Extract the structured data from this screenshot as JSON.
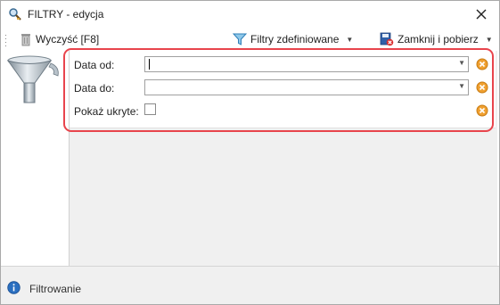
{
  "window": {
    "title": "FILTRY - edycja"
  },
  "toolbar": {
    "clear_label": "Wyczyść [F8]",
    "defined_filters_label": "Filtry zdefiniowane",
    "close_and_fetch_label": "Zamknij i pobierz"
  },
  "form": {
    "date_from": {
      "label": "Data od:",
      "value": ""
    },
    "date_to": {
      "label": "Data do:",
      "value": ""
    },
    "show_hidden": {
      "label": "Pokaż ukryte:",
      "checked": false
    }
  },
  "statusbar": {
    "text": "Filtrowanie"
  },
  "colors": {
    "highlight": "#e8444c",
    "clear_button": "#f0a030",
    "info_icon": "#2a6fc0"
  },
  "icons": [
    "search-key-icon",
    "close-icon",
    "trash-can-icon",
    "filter-icon",
    "close-fetch-icon",
    "funnel-icon",
    "clear-x-icon",
    "info-icon"
  ]
}
